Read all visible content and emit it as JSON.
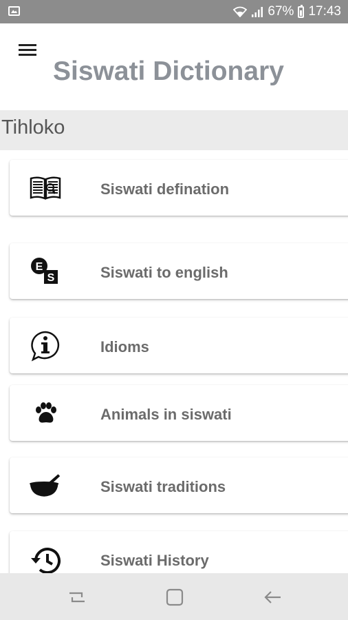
{
  "status_bar": {
    "battery": "67%",
    "time": "17:43"
  },
  "header": {
    "title": "Siswati Dictionary"
  },
  "section": {
    "title": "Tihloko"
  },
  "items": [
    {
      "label": "Siswati defination",
      "icon": "book-icon"
    },
    {
      "label": "Siswati to english",
      "icon": "translate-icon"
    },
    {
      "label": "Idioms",
      "icon": "info-bubble-icon"
    },
    {
      "label": "Animals in siswati",
      "icon": "paw-icon"
    },
    {
      "label": "Siswati traditions",
      "icon": "mortar-pestle-icon"
    },
    {
      "label": "Siswati History",
      "icon": "history-icon"
    }
  ],
  "translate_icon_letters": {
    "top": "E",
    "bottom": "S"
  },
  "colors": {
    "status_bar": "#8c8c8c",
    "title": "#8c9198",
    "section_bg": "#ebebeb",
    "nav_bar": "#e8e8e8"
  }
}
